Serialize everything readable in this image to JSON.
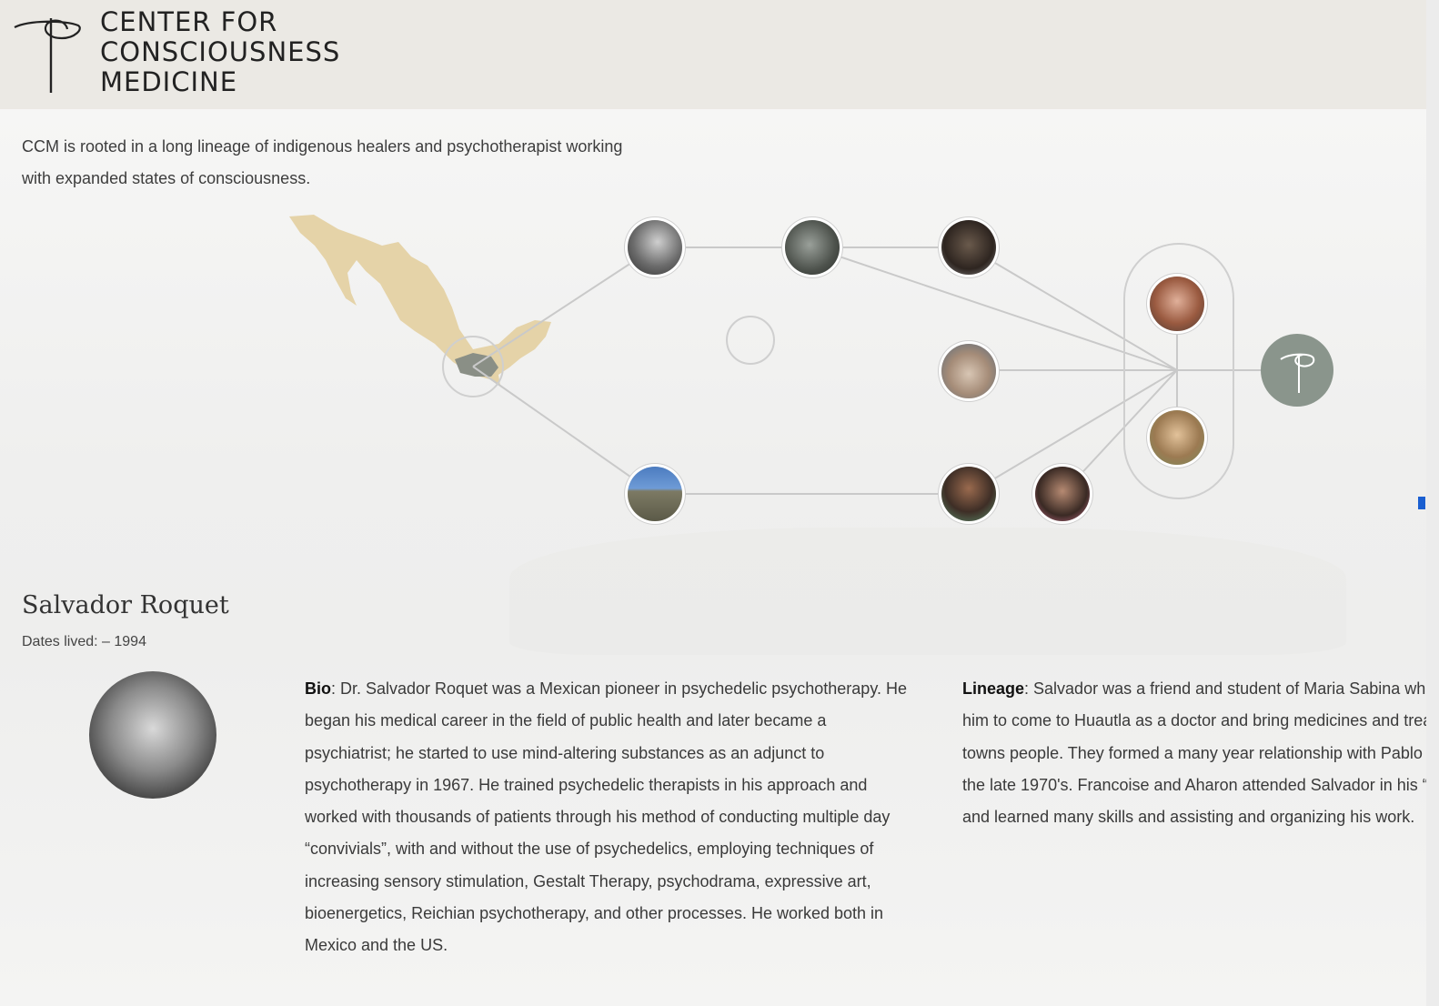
{
  "header": {
    "brand_lines": [
      "CENTER FOR",
      "CONSCIOUSNESS",
      "MEDICINE"
    ],
    "logo_icon": "ccm-logo-icon"
  },
  "intro": {
    "line1": "CCM is rooted in a long lineage of indigenous healers and psychotherapist working",
    "line2": "with expanded states of consciousness."
  },
  "lineage_map": {
    "map_color": "#e5d3a8",
    "line_color": "#c8c8c8",
    "final_node_color": "#8a958c",
    "nodes": [
      {
        "name": "mexico-region-node"
      },
      {
        "name": "healer-1-node"
      },
      {
        "name": "healer-2-node"
      },
      {
        "name": "healer-3-node"
      },
      {
        "name": "empty-node"
      },
      {
        "name": "healer-4-node"
      },
      {
        "name": "landscape-node"
      },
      {
        "name": "healer-5-node"
      },
      {
        "name": "healer-6-node"
      },
      {
        "name": "founder-1-node"
      },
      {
        "name": "founder-2-node"
      },
      {
        "name": "ccm-node"
      }
    ]
  },
  "person": {
    "name": "Salvador Roquet",
    "dates": "Dates lived: – 1994",
    "bio_label": "Bio",
    "bio_text": ": Dr. Salvador Roquet was a Mexican pioneer in psychedelic psychotherapy. He began his medical career in the field of public health and later became a psychiatrist; he started to use mind-altering substances as an adjunct to psychotherapy in 1967. He trained psychedelic therapists in his approach and worked with thousands of patients through his method of conducting multiple day “convivials”, with and without the use of psychedelics, employing techniques of increasing sensory stimulation, Gestalt Therapy, psychodrama, expressive art, bioenergetics, Reichian psychotherapy, and other processes. He worked both in Mexico and the US.",
    "lineage_label": "Lineage",
    "lineage_text": ": Salvador was a friend and student of Maria Sabina who invited him to come to Huautla as a doctor and bring medicines and treat the towns people. They formed a many year relationship with Pablo Sanchez in the late 1970's. Francoise and Aharon attended Salvador in his “convivials” and learned many skills and assisting and organizing his work."
  }
}
